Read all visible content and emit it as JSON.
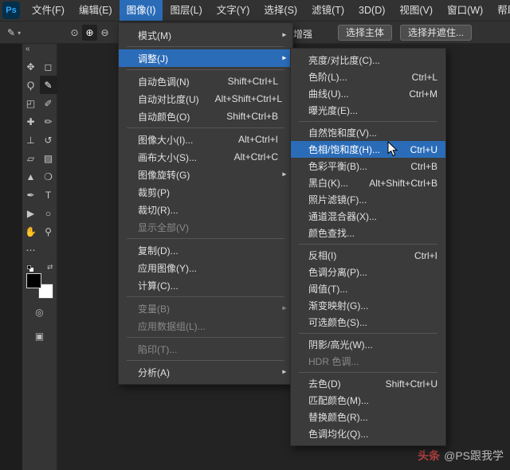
{
  "menubar": {
    "logo": "Ps",
    "items": [
      {
        "label": "文件(F)"
      },
      {
        "label": "编辑(E)"
      },
      {
        "label": "图像(I)",
        "active": true
      },
      {
        "label": "图层(L)"
      },
      {
        "label": "文字(Y)"
      },
      {
        "label": "选择(S)"
      },
      {
        "label": "滤镜(T)"
      },
      {
        "label": "3D(D)"
      },
      {
        "label": "视图(V)"
      },
      {
        "label": "窗口(W)"
      },
      {
        "label": "帮助(H)"
      }
    ]
  },
  "options_bar": {
    "preset_glyph": "✎",
    "preset_caret": "▾",
    "mode_icons": [
      {
        "name": "new-selection-icon",
        "glyph": "⊙"
      },
      {
        "name": "add-to-selection-icon",
        "glyph": "⊕",
        "active": true
      },
      {
        "name": "subtract-from-selection-icon",
        "glyph": "⊖"
      }
    ],
    "enhance_label": "增强",
    "select_subject_label": "选择主体",
    "select_and_mask_label": "选择并遮住..."
  },
  "toolbar": {
    "collapse_glyph": "«",
    "tools": [
      {
        "name": "move-tool",
        "glyph": "✥"
      },
      {
        "name": "rectangular-marquee-tool",
        "glyph": "◻"
      },
      {
        "name": "lasso-tool",
        "glyph": "Ϙ"
      },
      {
        "name": "quick-selection-tool",
        "glyph": "✎",
        "selected": true
      },
      {
        "name": "crop-tool",
        "glyph": "◰"
      },
      {
        "name": "eyedropper-tool",
        "glyph": "✐"
      },
      {
        "name": "healing-brush-tool",
        "glyph": "✚"
      },
      {
        "name": "brush-tool",
        "glyph": "✏"
      },
      {
        "name": "clone-stamp-tool",
        "glyph": "⊥"
      },
      {
        "name": "history-brush-tool",
        "glyph": "↺"
      },
      {
        "name": "eraser-tool",
        "glyph": "▱"
      },
      {
        "name": "gradient-tool",
        "glyph": "▨"
      },
      {
        "name": "blur-tool",
        "glyph": "▲"
      },
      {
        "name": "dodge-tool",
        "glyph": "❍"
      },
      {
        "name": "pen-tool",
        "glyph": "✒"
      },
      {
        "name": "type-tool",
        "glyph": "T"
      },
      {
        "name": "path-selection-tool",
        "glyph": "▶"
      },
      {
        "name": "shape-tool",
        "glyph": "○"
      },
      {
        "name": "hand-tool",
        "glyph": "✋"
      },
      {
        "name": "zoom-tool",
        "glyph": "⚲"
      },
      {
        "name": "edit-toolbar-button",
        "glyph": "⋯"
      }
    ],
    "foreground_color": "#000000",
    "background_color": "#ffffff",
    "swap_glyph": "⇄",
    "quick_mask_glyph": "◎",
    "screen_mode_glyph": "▣"
  },
  "image_menu": {
    "items": [
      {
        "label": "模式(M)",
        "submenu": true
      },
      {
        "sep": true
      },
      {
        "label": "调整(J)",
        "submenu": true,
        "highlight": true
      },
      {
        "sep": true
      },
      {
        "label": "自动色调(N)",
        "shortcut": "Shift+Ctrl+L"
      },
      {
        "label": "自动对比度(U)",
        "shortcut": "Alt+Shift+Ctrl+L"
      },
      {
        "label": "自动颜色(O)",
        "shortcut": "Shift+Ctrl+B"
      },
      {
        "sep": true
      },
      {
        "label": "图像大小(I)...",
        "shortcut": "Alt+Ctrl+I"
      },
      {
        "label": "画布大小(S)...",
        "shortcut": "Alt+Ctrl+C"
      },
      {
        "label": "图像旋转(G)",
        "submenu": true
      },
      {
        "label": "裁剪(P)"
      },
      {
        "label": "裁切(R)..."
      },
      {
        "label": "显示全部(V)",
        "disabled": true
      },
      {
        "sep": true
      },
      {
        "label": "复制(D)..."
      },
      {
        "label": "应用图像(Y)..."
      },
      {
        "label": "计算(C)..."
      },
      {
        "sep": true
      },
      {
        "label": "变量(B)",
        "submenu": true,
        "disabled": true
      },
      {
        "label": "应用数据组(L)...",
        "disabled": true
      },
      {
        "sep": true
      },
      {
        "label": "陷印(T)...",
        "disabled": true
      },
      {
        "sep": true
      },
      {
        "label": "分析(A)",
        "submenu": true
      }
    ]
  },
  "adjust_submenu": {
    "items": [
      {
        "label": "亮度/对比度(C)..."
      },
      {
        "label": "色阶(L)...",
        "shortcut": "Ctrl+L"
      },
      {
        "label": "曲线(U)...",
        "shortcut": "Ctrl+M"
      },
      {
        "label": "曝光度(E)..."
      },
      {
        "sep": true
      },
      {
        "label": "自然饱和度(V)..."
      },
      {
        "label": "色相/饱和度(H)...",
        "shortcut": "Ctrl+U",
        "highlight": true
      },
      {
        "label": "色彩平衡(B)...",
        "shortcut": "Ctrl+B"
      },
      {
        "label": "黑白(K)...",
        "shortcut": "Alt+Shift+Ctrl+B"
      },
      {
        "label": "照片滤镜(F)..."
      },
      {
        "label": "通道混合器(X)..."
      },
      {
        "label": "颜色查找..."
      },
      {
        "sep": true
      },
      {
        "label": "反相(I)",
        "shortcut": "Ctrl+I"
      },
      {
        "label": "色调分离(P)..."
      },
      {
        "label": "阈值(T)..."
      },
      {
        "label": "渐变映射(G)..."
      },
      {
        "label": "可选颜色(S)..."
      },
      {
        "sep": true
      },
      {
        "label": "阴影/高光(W)..."
      },
      {
        "label": "HDR 色调...",
        "disabled": true
      },
      {
        "sep": true
      },
      {
        "label": "去色(D)",
        "shortcut": "Shift+Ctrl+U"
      },
      {
        "label": "匹配颜色(M)..."
      },
      {
        "label": "替换颜色(R)..."
      },
      {
        "label": "色调均化(Q)..."
      }
    ]
  },
  "glyphs": {
    "submenu_arrow": "▶"
  },
  "watermark": {
    "brand": "头条",
    "handle": "@PS跟我学"
  },
  "colors": {
    "highlight_blue": "#2b6cb8",
    "menu_bg": "#3b3b3b",
    "bar_bg": "#323232",
    "canvas_bg": "#232323",
    "text": "#e0e0e0",
    "disabled_text": "#8a8a8a"
  }
}
